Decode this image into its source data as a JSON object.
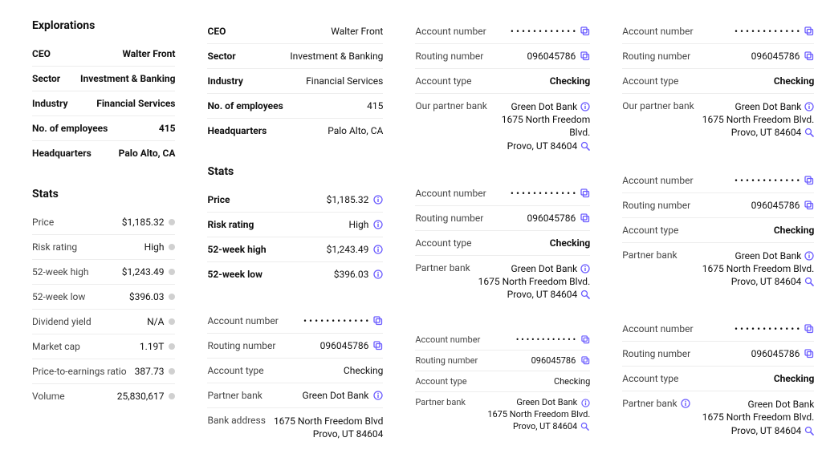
{
  "titles": {
    "explorations": "Explorations",
    "stats": "Stats"
  },
  "company": {
    "ceo_label": "CEO",
    "ceo_value": "Walter Front",
    "sector_label": "Sector",
    "sector_value": "Investment & Banking",
    "industry_label": "Industry",
    "industry_value": "Financial Services",
    "employees_label": "No. of employees",
    "employees_value": "415",
    "hq_label": "Headquarters",
    "hq_value": "Palo Alto, CA"
  },
  "stats": {
    "price_label": "Price",
    "price_value": "$1,185.32",
    "risk_label": "Risk rating",
    "risk_value": "High",
    "high52_label": "52-week high",
    "high52_value": "$1,243.49",
    "low52_label": "52-week low",
    "low52_value": "$396.03",
    "div_label": "Dividend yield",
    "div_value": "N/A",
    "mcap_label": "Market cap",
    "mcap_value": "1.19T",
    "pe_label": "Price-to-earnings ratio",
    "pe_value": "387.73",
    "vol_label": "Volume",
    "vol_value": "25,830,617"
  },
  "bank": {
    "acct_label": "Account number",
    "acct_mask": "• • • • • • • • • • • •",
    "routing_label": "Routing number",
    "routing_value": "096045786",
    "type_label": "Account type",
    "type_value": "Checking",
    "partner_label": "Partner bank",
    "our_partner_label": "Our partner bank",
    "partner_name": "Green Dot Bank",
    "addr_label": "Bank address",
    "addr_line1": "1675 North Freedom Blvd",
    "addr_line1_wrap_a": "1675 North Freedom",
    "addr_line1_wrap_b": "Blvd.",
    "addr_line1_dot": "1675 North Freedom Blvd.",
    "addr_line2": "Provo, UT 84604"
  }
}
